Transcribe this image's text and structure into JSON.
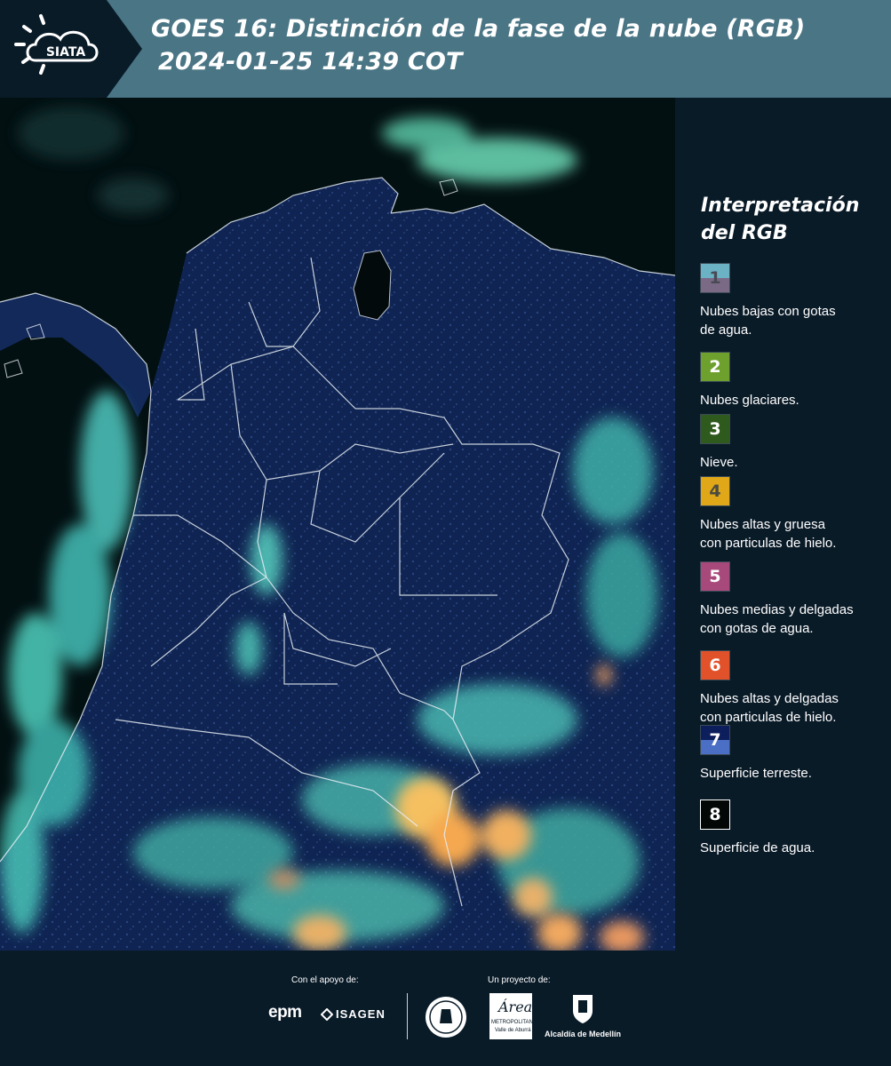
{
  "header": {
    "logo_text": "SIATA",
    "title_line1": "GOES 16: Distinción de la fase de la nube (RGB)",
    "title_line2": "2024-01-25 14:39 COT"
  },
  "legend": {
    "title_line1": "Interpretación",
    "title_line2": "del RGB",
    "items": [
      {
        "number": "1",
        "label_line1": "Nubes bajas con gotas",
        "label_line2": "de agua.",
        "color_top": "#6bb3c4",
        "color_bottom": "#7b6a86",
        "number_color": "#4a4a55"
      },
      {
        "number": "2",
        "label_line1": "Nubes glaciares.",
        "label_line2": "",
        "color_top": "#6ea02e",
        "color_bottom": "#6ea02e",
        "number_color": "#ffffff"
      },
      {
        "number": "3",
        "label_line1": "Nieve.",
        "label_line2": "",
        "color_top": "#2f5a1e",
        "color_bottom": "#2f5a1e",
        "number_color": "#ffffff"
      },
      {
        "number": "4",
        "label_line1": "Nubes altas y gruesa",
        "label_line2": "con particulas de hielo.",
        "color_top": "#e0a818",
        "color_bottom": "#e0a818",
        "number_color": "#4a4a40"
      },
      {
        "number": "5",
        "label_line1": "Nubes medias y delgadas",
        "label_line2": "con gotas de agua.",
        "color_top": "#a8497b",
        "color_bottom": "#a8497b",
        "number_color": "#ffffff"
      },
      {
        "number": "6",
        "label_line1": "Nubes altas y delgadas",
        "label_line2": "con particulas de hielo.",
        "color_top": "#e2522a",
        "color_bottom": "#e2522a",
        "number_color": "#ffffff"
      },
      {
        "number": "7",
        "label_line1": "Superficie terreste.",
        "label_line2": "",
        "color_top": "#0d1e5c",
        "color_bottom": "#4a6fc4",
        "number_color": "#ffffff"
      },
      {
        "number": "8",
        "label_line1": "Superficie de agua.",
        "label_line2": "",
        "color_top": "#030806",
        "color_bottom": "#030806",
        "number_color": "#ffffff"
      }
    ]
  },
  "footer": {
    "support_label": "Con el apoyo de:",
    "project_label": "Un proyecto de:",
    "sponsor_epm": "epm",
    "sponsor_isagen": "ISAGEN",
    "area_metropolitana_logo": "Área",
    "area_metropolitana_sub1": "METROPOLITANA",
    "area_metropolitana_sub2": "Valle de Aburrá",
    "alcaldia": "Alcaldía de Medellín"
  },
  "colors": {
    "header_bg": "#4a7585",
    "page_bg": "#0a1b28",
    "land": "#0f2452",
    "ocean": "#020d0f",
    "cloud_low": "#5fd0c0",
    "cloud_high": "#f5b04a",
    "border": "#e8eef5"
  }
}
